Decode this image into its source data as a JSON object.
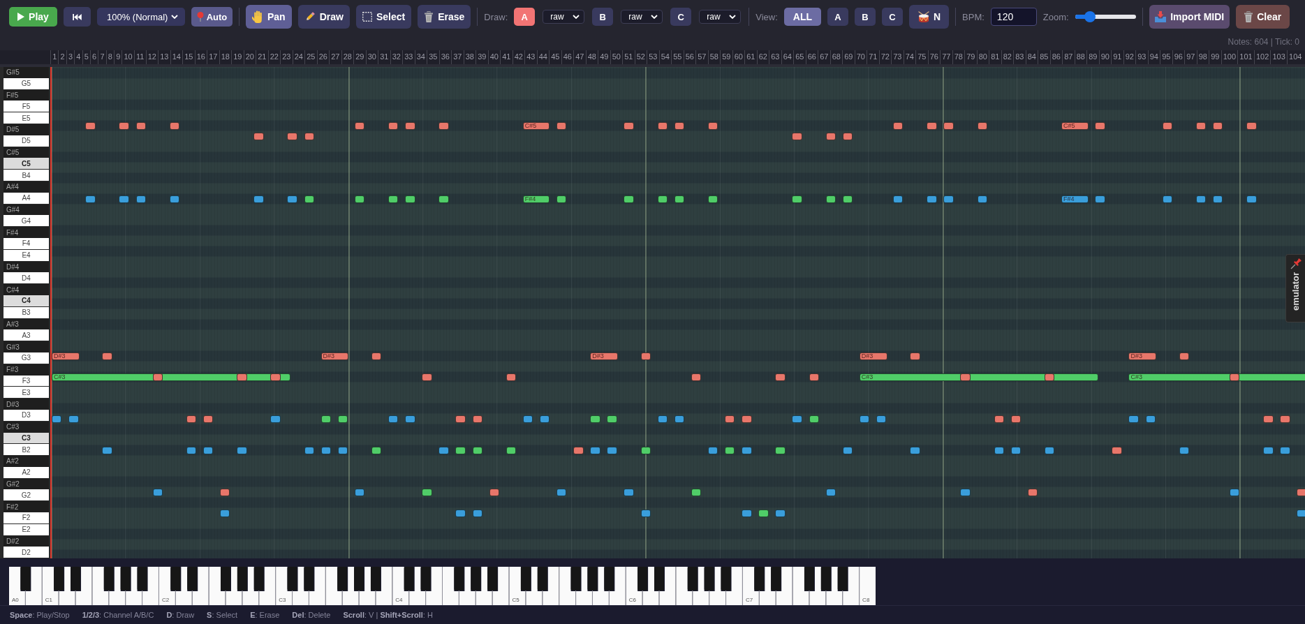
{
  "toolbar": {
    "play": {
      "label": "Play"
    },
    "speed": {
      "value": "100% (Normal)"
    },
    "auto": {
      "label": "Auto"
    },
    "tools": [
      {
        "kind": "pan",
        "label": "Pan",
        "selected": true
      },
      {
        "kind": "draw",
        "label": "Draw",
        "selected": false
      },
      {
        "kind": "select",
        "label": "Select",
        "selected": false
      },
      {
        "kind": "erase",
        "label": "Erase",
        "selected": false
      }
    ],
    "draw": {
      "label": "Draw:",
      "channels": [
        {
          "label": "A",
          "selected": true,
          "mode": "raw"
        },
        {
          "label": "B",
          "selected": false,
          "mode": "raw"
        },
        {
          "label": "C",
          "selected": false,
          "mode": "raw"
        }
      ]
    },
    "view": {
      "label": "View:",
      "options": [
        {
          "label": "ALL",
          "selected": true
        },
        {
          "label": "A",
          "selected": false
        },
        {
          "label": "B",
          "selected": false
        },
        {
          "label": "C",
          "selected": false
        }
      ]
    },
    "drum": {
      "label": "N"
    },
    "bpm": {
      "label": "BPM:",
      "value": "120"
    },
    "zoom": {
      "label": "Zoom:",
      "level": 0.24
    },
    "import": {
      "label": "Import MIDI"
    },
    "clear": {
      "label": "Clear"
    }
  },
  "status": {
    "text": "Notes: 604 | Tick: 0"
  },
  "ruler": {
    "labels": [
      "1",
      "2",
      "3",
      "4",
      "5",
      "6",
      "7",
      "8",
      "9",
      "10",
      "11",
      "12",
      "13",
      "14",
      "15",
      "16",
      "17",
      "18",
      "19",
      "20",
      "21",
      "22",
      "23",
      "24",
      "25",
      "26",
      "27",
      "28",
      "29",
      "30",
      "31",
      "32",
      "33",
      "34",
      "35",
      "36",
      "37",
      "38",
      "39",
      "40",
      "41",
      "42",
      "43",
      "44",
      "45",
      "46",
      "47",
      "48",
      "49",
      "50",
      "51",
      "52",
      "53",
      "54",
      "55",
      "56",
      "57",
      "58",
      "59",
      "60",
      "61",
      "62",
      "63",
      "64",
      "65",
      "66",
      "67",
      "68",
      "69",
      "70",
      "71",
      "72",
      "73",
      "74",
      "75",
      "76",
      "77",
      "78",
      "79",
      "80",
      "81",
      "82",
      "83",
      "84",
      "85",
      "86",
      "87",
      "88",
      "89",
      "90",
      "91",
      "92",
      "93",
      "94",
      "95",
      "96",
      "97",
      "98",
      "99",
      "100",
      "101",
      "102",
      "103",
      "104"
    ]
  },
  "piano_keys": [
    {
      "label": "G#5",
      "kind": "black"
    },
    {
      "label": "G5",
      "kind": "white"
    },
    {
      "label": "F#5",
      "kind": "black"
    },
    {
      "label": "F5",
      "kind": "white"
    },
    {
      "label": "E5",
      "kind": "white"
    },
    {
      "label": "D#5",
      "kind": "black"
    },
    {
      "label": "D5",
      "kind": "white"
    },
    {
      "label": "C#5",
      "kind": "black"
    },
    {
      "label": "C5",
      "kind": "octave"
    },
    {
      "label": "B4",
      "kind": "white"
    },
    {
      "label": "A#4",
      "kind": "black"
    },
    {
      "label": "A4",
      "kind": "white"
    },
    {
      "label": "G#4",
      "kind": "black"
    },
    {
      "label": "G4",
      "kind": "white"
    },
    {
      "label": "F#4",
      "kind": "black"
    },
    {
      "label": "F4",
      "kind": "white"
    },
    {
      "label": "E4",
      "kind": "white"
    },
    {
      "label": "D#4",
      "kind": "black"
    },
    {
      "label": "D4",
      "kind": "white"
    },
    {
      "label": "C#4",
      "kind": "black"
    },
    {
      "label": "C4",
      "kind": "octave"
    },
    {
      "label": "B3",
      "kind": "white"
    },
    {
      "label": "A#3",
      "kind": "black"
    },
    {
      "label": "A3",
      "kind": "white"
    },
    {
      "label": "G#3",
      "kind": "black"
    },
    {
      "label": "G3",
      "kind": "white"
    },
    {
      "label": "F#3",
      "kind": "black"
    },
    {
      "label": "F3",
      "kind": "white"
    },
    {
      "label": "E3",
      "kind": "white"
    },
    {
      "label": "D#3",
      "kind": "black"
    },
    {
      "label": "D3",
      "kind": "white"
    },
    {
      "label": "C#3",
      "kind": "black"
    },
    {
      "label": "C3",
      "kind": "octave"
    },
    {
      "label": "B2",
      "kind": "white"
    },
    {
      "label": "A#2",
      "kind": "black"
    },
    {
      "label": "A2",
      "kind": "white"
    },
    {
      "label": "G#2",
      "kind": "black"
    },
    {
      "label": "G2",
      "kind": "white"
    },
    {
      "label": "F#2",
      "kind": "black"
    },
    {
      "label": "F2",
      "kind": "white"
    },
    {
      "label": "E2",
      "kind": "white"
    },
    {
      "label": "D#2",
      "kind": "black"
    },
    {
      "label": "D2",
      "kind": "white"
    }
  ],
  "note_rows": [
    {
      "notes": [
        {
          "color": "#e8766a"
        },
        {
          "color": "#e8766a"
        },
        {
          "color": "#e8766a"
        },
        {
          "color": "#e8766a"
        },
        {
          "color": "#e8766a"
        },
        {
          "color": "#e8766a"
        },
        {
          "color": "#e8766a"
        },
        {
          "color": "#e8766a"
        },
        {
          "color": "#e8766a",
          "label": "C#5"
        },
        {
          "color": "#e8766a"
        },
        {
          "color": "#e8766a"
        },
        {
          "color": "#e8766a"
        },
        {
          "color": "#e8766a"
        },
        {
          "color": "#e8766a"
        },
        {
          "color": "#e8766a"
        },
        {
          "color": "#e8766a"
        },
        {
          "color": "#e8766a"
        },
        {
          "color": "#e8766a"
        },
        {
          "color": "#e8766a",
          "label": "C#5"
        },
        {
          "color": "#e8766a"
        },
        {
          "color": "#e8766a"
        },
        {
          "color": "#e8766a"
        },
        {
          "color": "#e8766a"
        },
        {
          "color": "#e8766a"
        }
      ]
    },
    {
      "notes": [
        {
          "color": "#e8766a"
        },
        {
          "color": "#e8766a"
        },
        {
          "color": "#e8766a"
        },
        {
          "color": "#e8766a"
        },
        {
          "color": "#e8766a"
        },
        {
          "color": "#e8766a"
        }
      ]
    },
    {
      "notes": [
        {
          "color": "#3a9edb"
        },
        {
          "color": "#3a9edb"
        },
        {
          "color": "#3a9edb"
        },
        {
          "color": "#3a9edb"
        },
        {
          "color": "#3a9edb"
        },
        {
          "color": "#3a9edb"
        },
        {
          "color": "#50cd68"
        },
        {
          "color": "#50cd68"
        },
        {
          "color": "#50cd68"
        },
        {
          "color": "#50cd68"
        },
        {
          "color": "#50cd68"
        },
        {
          "color": "#50cd68",
          "label": "F#4"
        },
        {
          "color": "#50cd68"
        },
        {
          "color": "#50cd68"
        },
        {
          "color": "#50cd68"
        },
        {
          "color": "#50cd68"
        },
        {
          "color": "#50cd68"
        },
        {
          "color": "#50cd68"
        },
        {
          "color": "#50cd68"
        },
        {
          "color": "#50cd68"
        },
        {
          "color": "#3a9edb"
        },
        {
          "color": "#3a9edb"
        },
        {
          "color": "#3a9edb"
        },
        {
          "color": "#3a9edb"
        },
        {
          "color": "#3a9edb",
          "label": "F#4"
        },
        {
          "color": "#3a9edb"
        },
        {
          "color": "#3a9edb"
        },
        {
          "color": "#3a9edb"
        },
        {
          "color": "#3a9edb"
        },
        {
          "color": "#3a9edb"
        }
      ]
    },
    {
      "notes": [
        {
          "color": "#e8766a",
          "label": "D#3"
        },
        {
          "color": "#e8766a"
        },
        {
          "color": "#e8766a",
          "label": "D#3"
        },
        {
          "color": "#e8766a"
        },
        {
          "color": "#e8766a",
          "label": "D#3"
        },
        {
          "color": "#e8766a"
        },
        {
          "color": "#e8766a",
          "label": "D#3"
        },
        {
          "color": "#e8766a"
        },
        {
          "color": "#e8766a",
          "label": "D#3"
        },
        {
          "color": "#e8766a"
        }
      ]
    },
    {
      "notes": [
        {
          "color": "#50cd68",
          "label": "C#3"
        },
        {
          "color": "#e8766a"
        },
        {
          "color": "#e8766a"
        },
        {
          "color": "#e8766a"
        },
        {
          "color": "#e8766a"
        },
        {
          "color": "#e8766a"
        },
        {
          "color": "#e8766a"
        },
        {
          "color": "#e8766a"
        },
        {
          "color": "#e8766a"
        },
        {
          "color": "#50cd68",
          "label": "C#3"
        },
        {
          "color": "#e8766a"
        },
        {
          "color": "#e8766a"
        },
        {
          "color": "#50cd68",
          "label": "C#3"
        },
        {
          "color": "#e8766a"
        }
      ]
    },
    {
      "notes": [
        {
          "color": "#3a9edb"
        },
        {
          "color": "#3a9edb"
        },
        {
          "color": "#e8766a"
        },
        {
          "color": "#e8766a"
        },
        {
          "color": "#3a9edb"
        },
        {
          "color": "#50cd68"
        },
        {
          "color": "#50cd68"
        },
        {
          "color": "#3a9edb"
        },
        {
          "color": "#3a9edb"
        },
        {
          "color": "#e8766a"
        },
        {
          "color": "#e8766a"
        },
        {
          "color": "#3a9edb"
        },
        {
          "color": "#3a9edb"
        },
        {
          "color": "#50cd68"
        },
        {
          "color": "#50cd68"
        },
        {
          "color": "#3a9edb"
        },
        {
          "color": "#3a9edb"
        },
        {
          "color": "#e8766a"
        },
        {
          "color": "#e8766a"
        },
        {
          "color": "#3a9edb"
        },
        {
          "color": "#50cd68"
        },
        {
          "color": "#3a9edb"
        },
        {
          "color": "#3a9edb"
        },
        {
          "color": "#e8766a"
        },
        {
          "color": "#e8766a"
        },
        {
          "color": "#3a9edb"
        },
        {
          "color": "#3a9edb"
        },
        {
          "color": "#e8766a"
        },
        {
          "color": "#e8766a"
        }
      ]
    },
    {
      "notes": [
        {
          "color": "#3a9edb"
        },
        {
          "color": "#3a9edb"
        },
        {
          "color": "#3a9edb"
        },
        {
          "color": "#3a9edb"
        },
        {
          "color": "#3a9edb"
        },
        {
          "color": "#3a9edb"
        },
        {
          "color": "#3a9edb"
        },
        {
          "color": "#50cd68"
        },
        {
          "color": "#3a9edb"
        },
        {
          "color": "#50cd68"
        },
        {
          "color": "#50cd68"
        },
        {
          "color": "#50cd68"
        },
        {
          "color": "#e8766a"
        },
        {
          "color": "#3a9edb"
        },
        {
          "color": "#3a9edb"
        },
        {
          "color": "#50cd68"
        },
        {
          "color": "#3a9edb"
        },
        {
          "color": "#50cd68"
        },
        {
          "color": "#3a9edb"
        },
        {
          "color": "#50cd68"
        },
        {
          "color": "#3a9edb"
        },
        {
          "color": "#3a9edb"
        },
        {
          "color": "#3a9edb"
        },
        {
          "color": "#3a9edb"
        },
        {
          "color": "#3a9edb"
        },
        {
          "color": "#e8766a"
        },
        {
          "color": "#3a9edb"
        },
        {
          "color": "#3a9edb"
        },
        {
          "color": "#3a9edb"
        }
      ]
    },
    {
      "notes": [
        {
          "color": "#3a9edb"
        },
        {
          "color": "#e8766a"
        },
        {
          "color": "#3a9edb"
        },
        {
          "color": "#50cd68"
        },
        {
          "color": "#e8766a"
        },
        {
          "color": "#3a9edb"
        },
        {
          "color": "#3a9edb"
        },
        {
          "color": "#50cd68"
        },
        {
          "color": "#3a9edb"
        },
        {
          "color": "#3a9edb"
        },
        {
          "color": "#e8766a"
        },
        {
          "color": "#3a9edb"
        },
        {
          "color": "#e8766a"
        }
      ]
    },
    {
      "notes": [
        {
          "color": "#3a9edb"
        },
        {
          "color": "#3a9edb"
        },
        {
          "color": "#3a9edb"
        },
        {
          "color": "#3a9edb"
        },
        {
          "color": "#3a9edb"
        },
        {
          "color": "#50cd68"
        },
        {
          "color": "#3a9edb"
        },
        {
          "color": "#3a9edb"
        }
      ]
    }
  ],
  "emulator_tab": {
    "label": "emulator"
  },
  "keyboard": {
    "labels": [
      "A0",
      "C1",
      "C2",
      "C3",
      "C4",
      "C5",
      "C6",
      "C7",
      "C8"
    ]
  },
  "shortcuts": [
    "**Space**: Play/Stop",
    "**1/2/3**: Channel A/B/C",
    "**D**: Draw",
    "**S**: Select",
    "**E**: Erase",
    "**Del**: Delete",
    "**Scroll**: V | **Shift+Scroll**: H"
  ]
}
